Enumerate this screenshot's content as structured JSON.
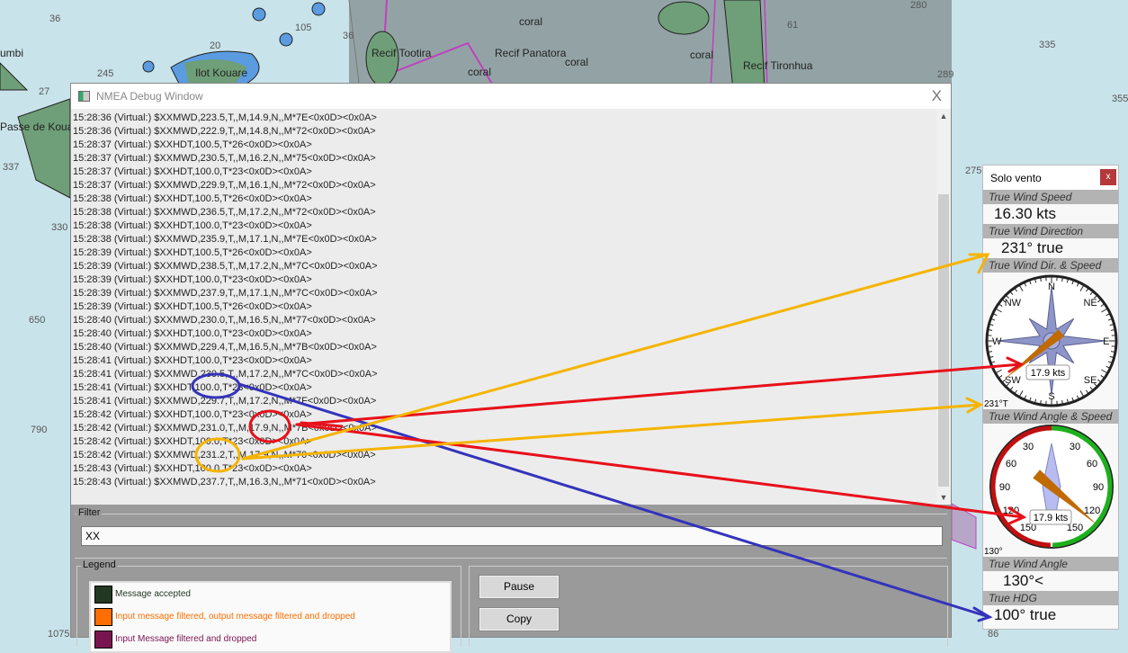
{
  "map": {
    "labels": [
      "Recif Tootira",
      "Recif Panatora",
      "coral",
      "coral",
      "coral",
      "coral",
      "Recif Tironhua",
      "Ilot Kouare",
      "umbi",
      "Passe de Koua"
    ],
    "depths": [
      "36",
      "20",
      "245",
      "27",
      "105",
      "36",
      "61",
      "280",
      "335",
      "289",
      "355",
      "275",
      "330",
      "337",
      "650",
      "790",
      "1075",
      "86"
    ]
  },
  "window": {
    "title": "NMEA Debug Window",
    "close_label": "X",
    "log": [
      "15:28:36 (Virtual:) $XXMWD,223.5,T,,M,14.9,N,,M*7E<0x0D><0x0A>",
      "15:28:36 (Virtual:) $XXMWD,222.9,T,,M,14.8,N,,M*72<0x0D><0x0A>",
      "15:28:37 (Virtual:) $XXHDT,100.5,T*26<0x0D><0x0A>",
      "15:28:37 (Virtual:) $XXMWD,230.5,T,,M,16.2,N,,M*75<0x0D><0x0A>",
      "15:28:37 (Virtual:) $XXHDT,100.0,T*23<0x0D><0x0A>",
      "15:28:37 (Virtual:) $XXMWD,229.9,T,,M,16.1,N,,M*72<0x0D><0x0A>",
      "15:28:38 (Virtual:) $XXHDT,100.5,T*26<0x0D><0x0A>",
      "15:28:38 (Virtual:) $XXMWD,236.5,T,,M,17.2,N,,M*72<0x0D><0x0A>",
      "15:28:38 (Virtual:) $XXHDT,100.0,T*23<0x0D><0x0A>",
      "15:28:38 (Virtual:) $XXMWD,235.9,T,,M,17.1,N,,M*7E<0x0D><0x0A>",
      "15:28:39 (Virtual:) $XXHDT,100.5,T*26<0x0D><0x0A>",
      "15:28:39 (Virtual:) $XXMWD,238.5,T,,M,17.2,N,,M*7C<0x0D><0x0A>",
      "15:28:39 (Virtual:) $XXHDT,100.0,T*23<0x0D><0x0A>",
      "15:28:39 (Virtual:) $XXMWD,237.9,T,,M,17.1,N,,M*7C<0x0D><0x0A>",
      "15:28:39 (Virtual:) $XXHDT,100.5,T*26<0x0D><0x0A>",
      "15:28:40 (Virtual:) $XXMWD,230.0,T,,M,16.5,N,,M*77<0x0D><0x0A>",
      "15:28:40 (Virtual:) $XXHDT,100.0,T*23<0x0D><0x0A>",
      "15:28:40 (Virtual:) $XXMWD,229.4,T,,M,16.5,N,,M*7B<0x0D><0x0A>",
      "15:28:41 (Virtual:) $XXHDT,100.0,T*23<0x0D><0x0A>",
      "15:28:41 (Virtual:) $XXMWD,230.5,T,,M,17.2,N,,M*7C<0x0D><0x0A>",
      "15:28:41 (Virtual:) $XXHDT,100.0,T*23<0x0D><0x0A>",
      "15:28:41 (Virtual:) $XXMWD,229.7,T,,M,17.2,N,,M*7F<0x0D><0x0A>",
      "15:28:42 (Virtual:) $XXHDT,100.0,T*23<0x0D><0x0A>",
      "15:28:42 (Virtual:) $XXMWD,231.0,T,,M,17.9,N,,M*7B<0x0D><0x0A>",
      "15:28:42 (Virtual:) $XXHDT,100.0,T*23<0x0D><0x0A>",
      "15:28:42 (Virtual:) $XXMWD,231.2,T,,M,17.9,N,,M*70<0x0D><0x0A>",
      "15:28:43 (Virtual:) $XXHDT,100.0,T*23<0x0D><0x0A>",
      "15:28:43 (Virtual:) $XXMWD,237.7,T,,M,16.3,N,,M*71<0x0D><0x0A>"
    ],
    "filter": {
      "label": "Filter",
      "value": "XX"
    },
    "legend": {
      "label": "Legend",
      "items": [
        {
          "text": "Message accepted",
          "color": "#223822",
          "text_color": "#223822"
        },
        {
          "text": "Input message filtered, output message filtered and dropped",
          "color": "#ff6e00",
          "text_color": "#ff6e00"
        },
        {
          "text": "Input Message filtered and dropped",
          "color": "#7a1450",
          "text_color": "#7a1450"
        }
      ]
    },
    "buttons": {
      "pause": "Pause",
      "copy": "Copy"
    }
  },
  "panel": {
    "title": "Solo vento",
    "close_label": "x",
    "tws": {
      "label": "True Wind Speed",
      "value": "16.30 kts"
    },
    "twd": {
      "label": "True Wind Direction",
      "value": "231° true"
    },
    "compass": {
      "label": "True Wind Dir. & Speed",
      "cardinals": [
        "N",
        "NE",
        "E",
        "SE",
        "S",
        "SW",
        "W",
        "NW"
      ],
      "speed": "17.9 kts",
      "direction_deg": 231,
      "readout": "231°T"
    },
    "twa_gauge": {
      "label": "True Wind Angle & Speed",
      "ticks": [
        "30",
        "60",
        "90",
        "120",
        "150",
        "30",
        "60",
        "90",
        "120",
        "150"
      ],
      "speed": "17.9 kts",
      "angle_deg": 130,
      "readout": "130°"
    },
    "twa": {
      "label": "True Wind Angle",
      "value": "130°<"
    },
    "hdg": {
      "label": "True HDG",
      "value": "100° true"
    }
  },
  "annotations": {
    "heading_color": "#3333bb",
    "speed_color": "#e8101a",
    "direction_color": "#f5b400"
  }
}
